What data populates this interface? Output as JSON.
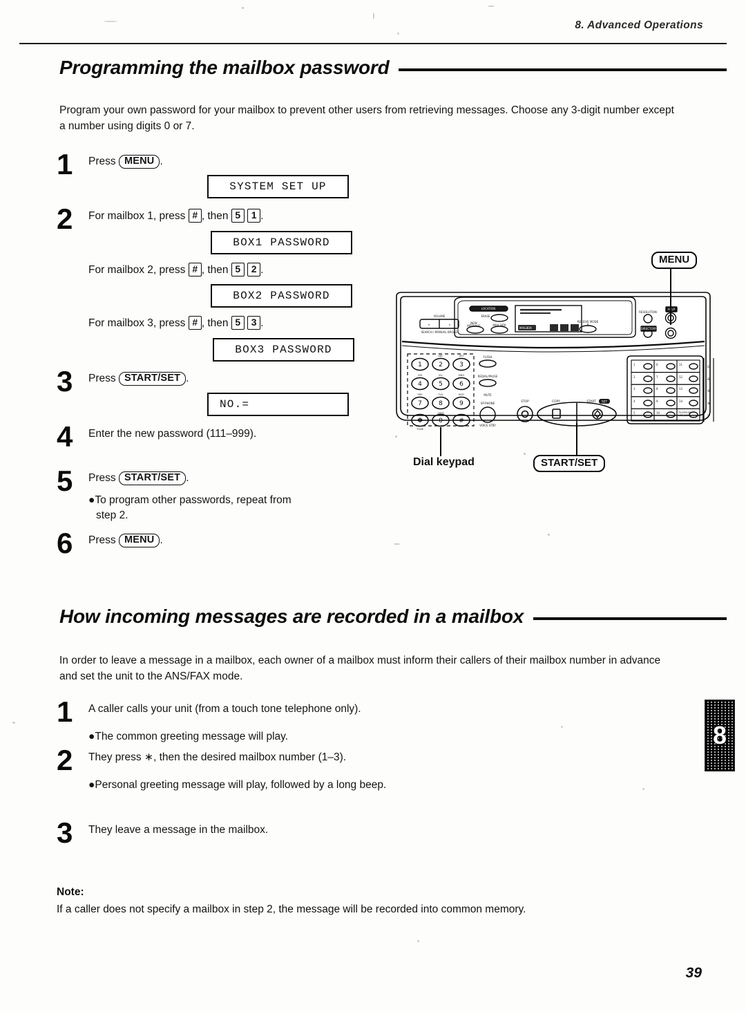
{
  "header": {
    "chapter": "8.  Advanced Operations"
  },
  "page": {
    "number": "39",
    "thumb_tab": "8"
  },
  "sections": [
    {
      "title": "Programming the mailbox password",
      "intro": "Program your own password for your mailbox to prevent other users from retrieving messages. Choose any 3-digit number except a number using digits 0 or 7.",
      "steps": [
        {
          "num": "1",
          "text_before": "Press",
          "key": "MENU",
          "text_after": "."
        },
        {
          "num": "2",
          "text": "For mailbox 1, press",
          "key1": "#",
          "mid": ", then",
          "key2": "5",
          "key3": "1",
          "end": "."
        },
        {
          "num": "3",
          "text_before": "Press",
          "key": "START/SET",
          "text_after": "."
        },
        {
          "num": "4",
          "text": "Enter the new password (111–999)."
        },
        {
          "num": "5",
          "text_before": "Press",
          "key": "START/SET",
          "text_after": ".",
          "bullet": "●To program other passwords, repeat from",
          "bullet_line2": "step 2."
        },
        {
          "num": "6",
          "text_before": "Press",
          "key": "MENU",
          "text_after": "."
        }
      ],
      "mailbox_lines": [
        {
          "label_a": "For mailbox 1, press",
          "k1": "#",
          "label_b": ", then",
          "k2": "5",
          "k3": "1",
          "end": ".",
          "lcd": "SYSTEM SET UP"
        },
        {
          "label_a": "For mailbox 2, press",
          "k1": "#",
          "label_b": ", then",
          "k2": "5",
          "k3": "2",
          "end": ".",
          "lcd": "BOX2 PASSWORD"
        },
        {
          "label_a": "For mailbox 3, press",
          "k1": "#",
          "label_b": ", then",
          "k2": "5",
          "k3": "3",
          "end": ".",
          "lcd": "BOX3 PASSWORD"
        }
      ],
      "displays": {
        "d1": "SYSTEM SET UP",
        "d2": "BOX1 PASSWORD",
        "d3": "BOX2 PASSWORD",
        "d4": "BOX3 PASSWORD",
        "d5": "NO.="
      }
    },
    {
      "title": "How incoming messages are recorded in a mailbox",
      "intro": "In order to leave a message in a mailbox, each owner of a mailbox must inform their callers of their mailbox number in advance and set the unit to the ANS/FAX mode.",
      "steps": [
        {
          "num": "1",
          "text": "A caller calls your unit (from a touch tone telephone only).",
          "bullet": "●The common greeting message will play."
        },
        {
          "num": "2",
          "text": "They press ∗, then the desired mailbox number (1–3).",
          "bullet": "●Personal greeting message will play, followed by a long beep."
        },
        {
          "num": "3",
          "text": "They leave a message in the mailbox."
        }
      ]
    }
  ],
  "note": {
    "label": "Note:",
    "body": "If a caller does not specify a mailbox in step 2, the message will be recorded into common memory."
  },
  "figure": {
    "callouts": {
      "menu": "MENU",
      "dial_keypad": "Dial keypad",
      "start_set": "START/SET"
    },
    "keypad_keys": [
      "1",
      "2",
      "3",
      "4",
      "5",
      "6",
      "7",
      "8",
      "9",
      "∗",
      "0",
      "#"
    ],
    "keypad_letters": [
      "",
      "ABC",
      "DEF",
      "GHI",
      "JKL",
      "MNO",
      "PRS",
      "TUV",
      "WXY",
      "TONE",
      "OPER",
      ""
    ],
    "side_buttons": [
      "FLASH",
      "REDIAL/PAUSE",
      "MUTE",
      "SP-PHONE"
    ],
    "center_buttons": [
      "STOP",
      "COPY",
      "START/SET"
    ],
    "panel_buttons": [
      "VOLUME",
      "ERASE",
      "NEW MESSAGE",
      "MAIL BOX",
      "RECEIVE MODE",
      "RESOLUTION",
      "HELP",
      "DIRECTORY",
      "CLEAR"
    ],
    "station_rows": 5,
    "station_cols": 3,
    "station_last_label": "TELEPHONE\nLINE JACK"
  }
}
